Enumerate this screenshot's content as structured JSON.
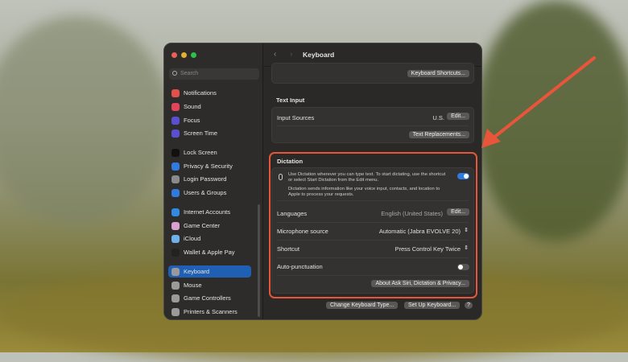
{
  "window": {
    "title": "Keyboard",
    "back": "‹",
    "forward": "›"
  },
  "sidebar": {
    "search_placeholder": "Search",
    "items": [
      {
        "label": "Notifications",
        "color": "#e2504a"
      },
      {
        "label": "Sound",
        "color": "#e2445a"
      },
      {
        "label": "Focus",
        "color": "#5b4fd1"
      },
      {
        "label": "Screen Time",
        "color": "#5b4fd1"
      },
      {
        "label": "Lock Screen",
        "color": "#111111"
      },
      {
        "label": "Privacy & Security",
        "color": "#2f7be0"
      },
      {
        "label": "Login Password",
        "color": "#8a8a8a"
      },
      {
        "label": "Users & Groups",
        "color": "#2f7be0"
      },
      {
        "label": "Internet Accounts",
        "color": "#2f8ae0"
      },
      {
        "label": "Game Center",
        "color": "#d9a0d0"
      },
      {
        "label": "iCloud",
        "color": "#6fb0e8"
      },
      {
        "label": "Wallet & Apple Pay",
        "color": "#222222"
      },
      {
        "label": "Keyboard",
        "color": "#9a9a9a"
      },
      {
        "label": "Mouse",
        "color": "#9a9a9a"
      },
      {
        "label": "Game Controllers",
        "color": "#9a9a9a"
      },
      {
        "label": "Printers & Scanners",
        "color": "#9a9a9a"
      }
    ]
  },
  "main": {
    "keyboard_shortcuts": "Keyboard Shortcuts...",
    "text_input": {
      "heading": "Text Input",
      "input_sources": "Input Sources",
      "input_value": "U.S.",
      "edit": "Edit...",
      "text_replacements": "Text Replacements..."
    },
    "dictation": {
      "heading": "Dictation",
      "desc1": "Use Dictation wherever you can type text. To start dictating, use the shortcut or select Start Dictation from the Edit menu.",
      "desc2": "Dictation sends information like your voice input, contacts, and location to Apple to process your requests.",
      "enabled": true,
      "languages": "Languages",
      "languages_value": "English (United States)",
      "edit": "Edit...",
      "mic": "Microphone source",
      "mic_value": "Automatic (Jabra EVOLVE 20)",
      "shortcut": "Shortcut",
      "shortcut_value": "Press Control Key Twice",
      "autopunct": "Auto-punctuation",
      "autopunct_enabled": false,
      "about": "About Ask Siri, Dictation & Privacy..."
    },
    "change_type": "Change Keyboard Type...",
    "setup": "Set Up Keyboard...",
    "help": "?"
  },
  "accent": "#e8553a"
}
